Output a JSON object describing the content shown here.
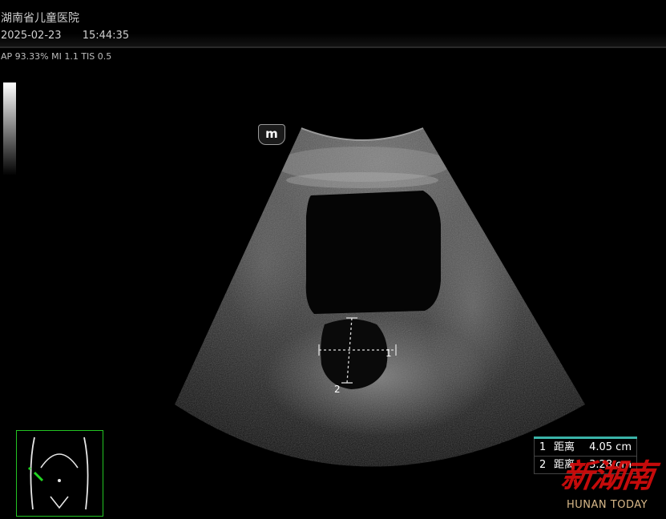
{
  "header": {
    "hospital": "湖南省儿童医院",
    "date": "2025-02-23",
    "time": "15:44:35",
    "params": "AP 93.33%  MI 1.1 TIS 0.5"
  },
  "probe_logo": "m",
  "calipers": {
    "label_1": "1",
    "label_2": "2"
  },
  "measurements": [
    {
      "index": "1",
      "label": "距离",
      "value": "4.05 cm"
    },
    {
      "index": "2",
      "label": "距离",
      "value": "3.28 cm"
    }
  ],
  "watermark": {
    "cn": "新湖南",
    "en": "HUNAN TODAY"
  },
  "colors": {
    "top_bar": "#d10000",
    "table_accent": "#3ab3a8",
    "body_marker": "#23c423",
    "watermark_red": "#d60d0d"
  }
}
